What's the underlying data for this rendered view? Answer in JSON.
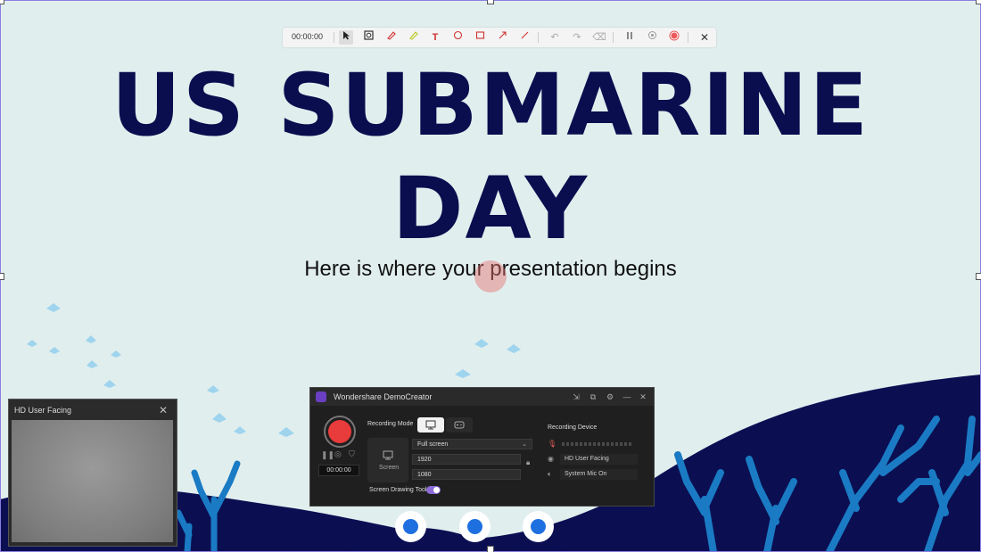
{
  "slide": {
    "title_line1": "US SUBMARINE",
    "title_line2": "DAY",
    "subtitle": "Here is where your presentation begins"
  },
  "toolbar": {
    "timer": "00:00:00",
    "tools": [
      "cursor-icon",
      "spotlight-icon",
      "pen-icon",
      "highlighter-icon",
      "text-icon",
      "circle-icon",
      "rectangle-icon",
      "arrow-icon",
      "line-icon",
      "undo-icon",
      "redo-icon",
      "eraser-icon",
      "pause-icon",
      "restart-icon",
      "record-stop-icon",
      "close-icon"
    ]
  },
  "webcam": {
    "title": "HD User Facing"
  },
  "recorder": {
    "title": "Wondershare DemoCreator",
    "timer": "00:00:00",
    "recording_mode_label": "Recording Mode",
    "screen_label": "Screen",
    "capture_area": "Full screen",
    "width": "1920",
    "height": "1080",
    "drawing_tool_label": "Screen Drawing Tool",
    "drawing_tool_enabled": true,
    "recording_device_label": "Recording Device",
    "camera_device": "HD User Facing",
    "mic_device": "System Mic On"
  },
  "colors": {
    "slide_bg": "#e1eeee",
    "title": "#0a0d4e",
    "coral": "#1a7bc4",
    "fish": "#9fd4ee",
    "record_red": "#e83b3b",
    "accent_purple": "#8b6bd8"
  }
}
